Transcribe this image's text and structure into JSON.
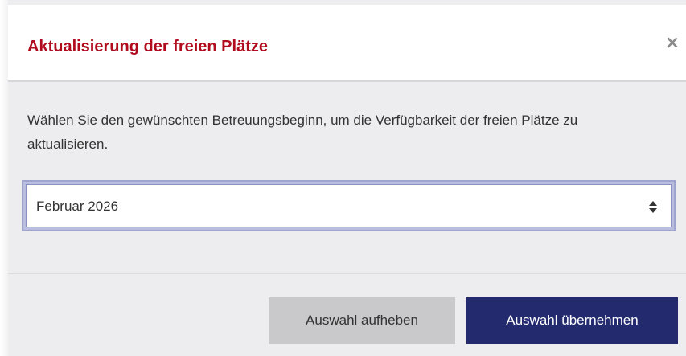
{
  "dialog": {
    "title": "Aktualisierung der freien Plätze",
    "close_label": "×",
    "description": "Wählen Sie den gewünschten Betreuungsbeginn, um die Verfügbarkeit der freien Plätze zu aktualisieren.",
    "select": {
      "value": "Februar 2026"
    },
    "buttons": {
      "clear_label": "Auswahl aufheben",
      "apply_label": "Auswahl übernehmen"
    },
    "colors": {
      "title": "#b00c1e",
      "primary_button": "#232b6e",
      "secondary_button": "#c9c9cb"
    }
  }
}
